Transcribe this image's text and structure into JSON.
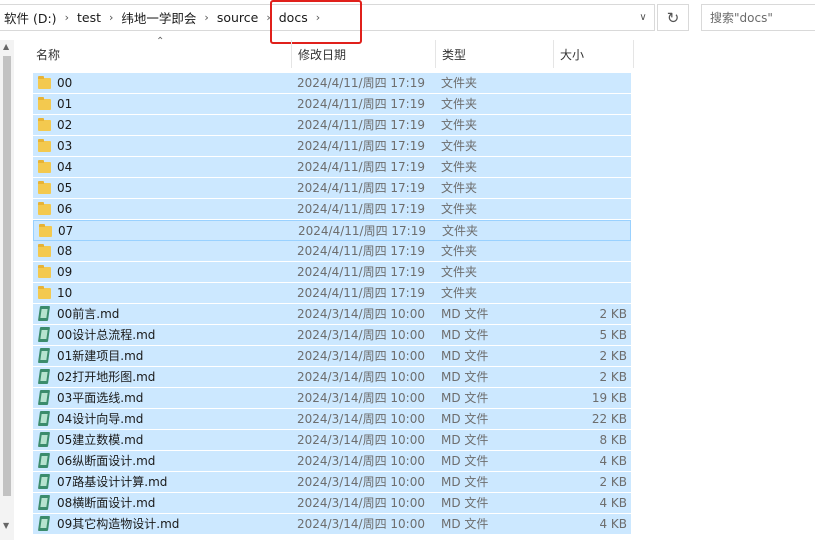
{
  "address": {
    "crumbs": [
      "软件 (D:)",
      "test",
      "纬地一学即会",
      "source",
      "docs"
    ],
    "separator": "›",
    "dropdown_icon": "chevron-down",
    "refresh_icon": "refresh",
    "search_placeholder": "搜索\"docs\""
  },
  "columns": {
    "name": "名称",
    "date": "修改日期",
    "type": "类型",
    "size": "大小"
  },
  "files": [
    {
      "name": "00",
      "date": "2024/4/11/周四 17:19",
      "type": "文件夹",
      "size": "",
      "icon": "folder-icon"
    },
    {
      "name": "01",
      "date": "2024/4/11/周四 17:19",
      "type": "文件夹",
      "size": "",
      "icon": "folder-icon"
    },
    {
      "name": "02",
      "date": "2024/4/11/周四 17:19",
      "type": "文件夹",
      "size": "",
      "icon": "folder-icon"
    },
    {
      "name": "03",
      "date": "2024/4/11/周四 17:19",
      "type": "文件夹",
      "size": "",
      "icon": "folder-icon"
    },
    {
      "name": "04",
      "date": "2024/4/11/周四 17:19",
      "type": "文件夹",
      "size": "",
      "icon": "folder-icon"
    },
    {
      "name": "05",
      "date": "2024/4/11/周四 17:19",
      "type": "文件夹",
      "size": "",
      "icon": "folder-icon"
    },
    {
      "name": "06",
      "date": "2024/4/11/周四 17:19",
      "type": "文件夹",
      "size": "",
      "icon": "folder-icon"
    },
    {
      "name": "07",
      "date": "2024/4/11/周四 17:19",
      "type": "文件夹",
      "size": "",
      "icon": "folder-icon"
    },
    {
      "name": "08",
      "date": "2024/4/11/周四 17:19",
      "type": "文件夹",
      "size": "",
      "icon": "folder-icon"
    },
    {
      "name": "09",
      "date": "2024/4/11/周四 17:19",
      "type": "文件夹",
      "size": "",
      "icon": "folder-icon"
    },
    {
      "name": "10",
      "date": "2024/4/11/周四 17:19",
      "type": "文件夹",
      "size": "",
      "icon": "folder-icon"
    },
    {
      "name": "00前言.md",
      "date": "2024/3/14/周四 10:00",
      "type": "MD 文件",
      "size": "2 KB",
      "icon": "md-file-icon"
    },
    {
      "name": "00设计总流程.md",
      "date": "2024/3/14/周四 10:00",
      "type": "MD 文件",
      "size": "5 KB",
      "icon": "md-file-icon"
    },
    {
      "name": "01新建项目.md",
      "date": "2024/3/14/周四 10:00",
      "type": "MD 文件",
      "size": "2 KB",
      "icon": "md-file-icon"
    },
    {
      "name": "02打开地形图.md",
      "date": "2024/3/14/周四 10:00",
      "type": "MD 文件",
      "size": "2 KB",
      "icon": "md-file-icon"
    },
    {
      "name": "03平面选线.md",
      "date": "2024/3/14/周四 10:00",
      "type": "MD 文件",
      "size": "19 KB",
      "icon": "md-file-icon"
    },
    {
      "name": "04设计向导.md",
      "date": "2024/3/14/周四 10:00",
      "type": "MD 文件",
      "size": "22 KB",
      "icon": "md-file-icon"
    },
    {
      "name": "05建立数模.md",
      "date": "2024/3/14/周四 10:00",
      "type": "MD 文件",
      "size": "8 KB",
      "icon": "md-file-icon"
    },
    {
      "name": "06纵断面设计.md",
      "date": "2024/3/14/周四 10:00",
      "type": "MD 文件",
      "size": "4 KB",
      "icon": "md-file-icon"
    },
    {
      "name": "07路基设计计算.md",
      "date": "2024/3/14/周四 10:00",
      "type": "MD 文件",
      "size": "2 KB",
      "icon": "md-file-icon"
    },
    {
      "name": "08横断面设计.md",
      "date": "2024/3/14/周四 10:00",
      "type": "MD 文件",
      "size": "4 KB",
      "icon": "md-file-icon"
    },
    {
      "name": "09其它构造物设计.md",
      "date": "2024/3/14/周四 10:00",
      "type": "MD 文件",
      "size": "4 KB",
      "icon": "md-file-icon"
    }
  ],
  "focused_row": 7,
  "colors": {
    "selection": "#cce8ff",
    "focus_border": "#99d1ff",
    "annotation": "#e0201b"
  }
}
